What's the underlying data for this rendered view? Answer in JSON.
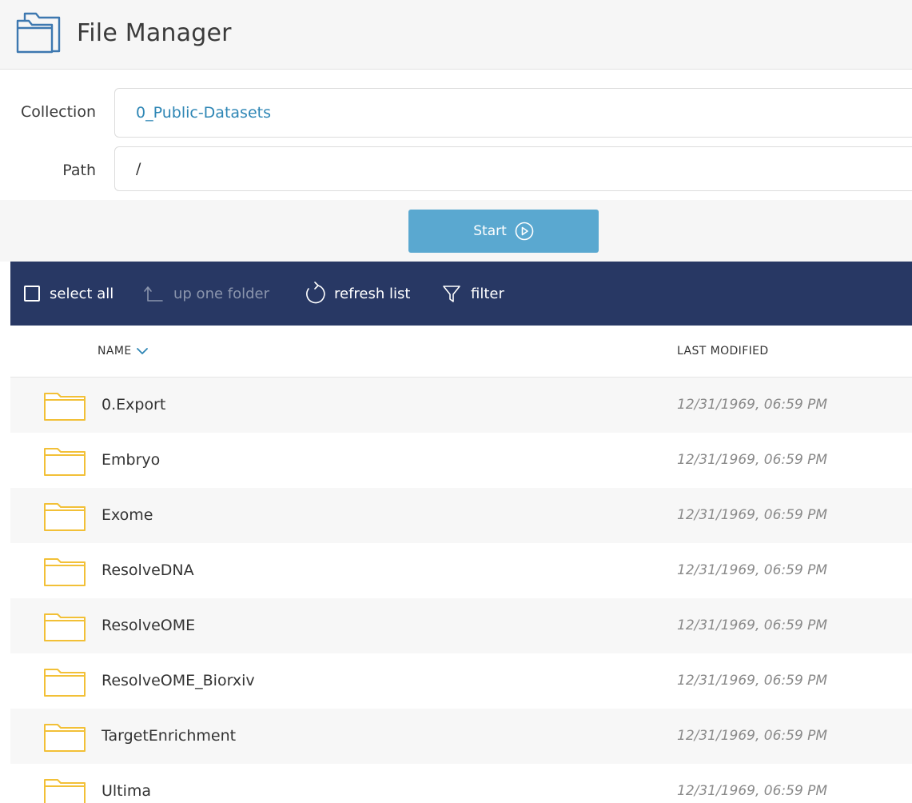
{
  "header": {
    "title": "File Manager",
    "icon": "folder-stack-icon"
  },
  "form": {
    "collection_label": "Collection",
    "collection_value": "0_Public-Datasets",
    "path_label": "Path",
    "path_value": "/"
  },
  "start": {
    "label": "Start",
    "icon": "play-circle-icon",
    "color": "#5aa8d0"
  },
  "toolbar": {
    "select_all": "select all",
    "up_one_folder": "up one folder",
    "refresh_list": "refresh list",
    "filter": "filter",
    "background": "#283864"
  },
  "columns": {
    "name": "NAME",
    "last_modified": "LAST MODIFIED"
  },
  "files": [
    {
      "name": "0.Export",
      "modified": "12/31/1969, 06:59 PM"
    },
    {
      "name": "Embryo",
      "modified": "12/31/1969, 06:59 PM"
    },
    {
      "name": "Exome",
      "modified": "12/31/1969, 06:59 PM"
    },
    {
      "name": "ResolveDNA",
      "modified": "12/31/1969, 06:59 PM"
    },
    {
      "name": "ResolveOME",
      "modified": "12/31/1969, 06:59 PM"
    },
    {
      "name": "ResolveOME_Biorxiv",
      "modified": "12/31/1969, 06:59 PM"
    },
    {
      "name": "TargetEnrichment",
      "modified": "12/31/1969, 06:59 PM"
    },
    {
      "name": "Ultima",
      "modified": "12/31/1969, 06:59 PM"
    }
  ]
}
